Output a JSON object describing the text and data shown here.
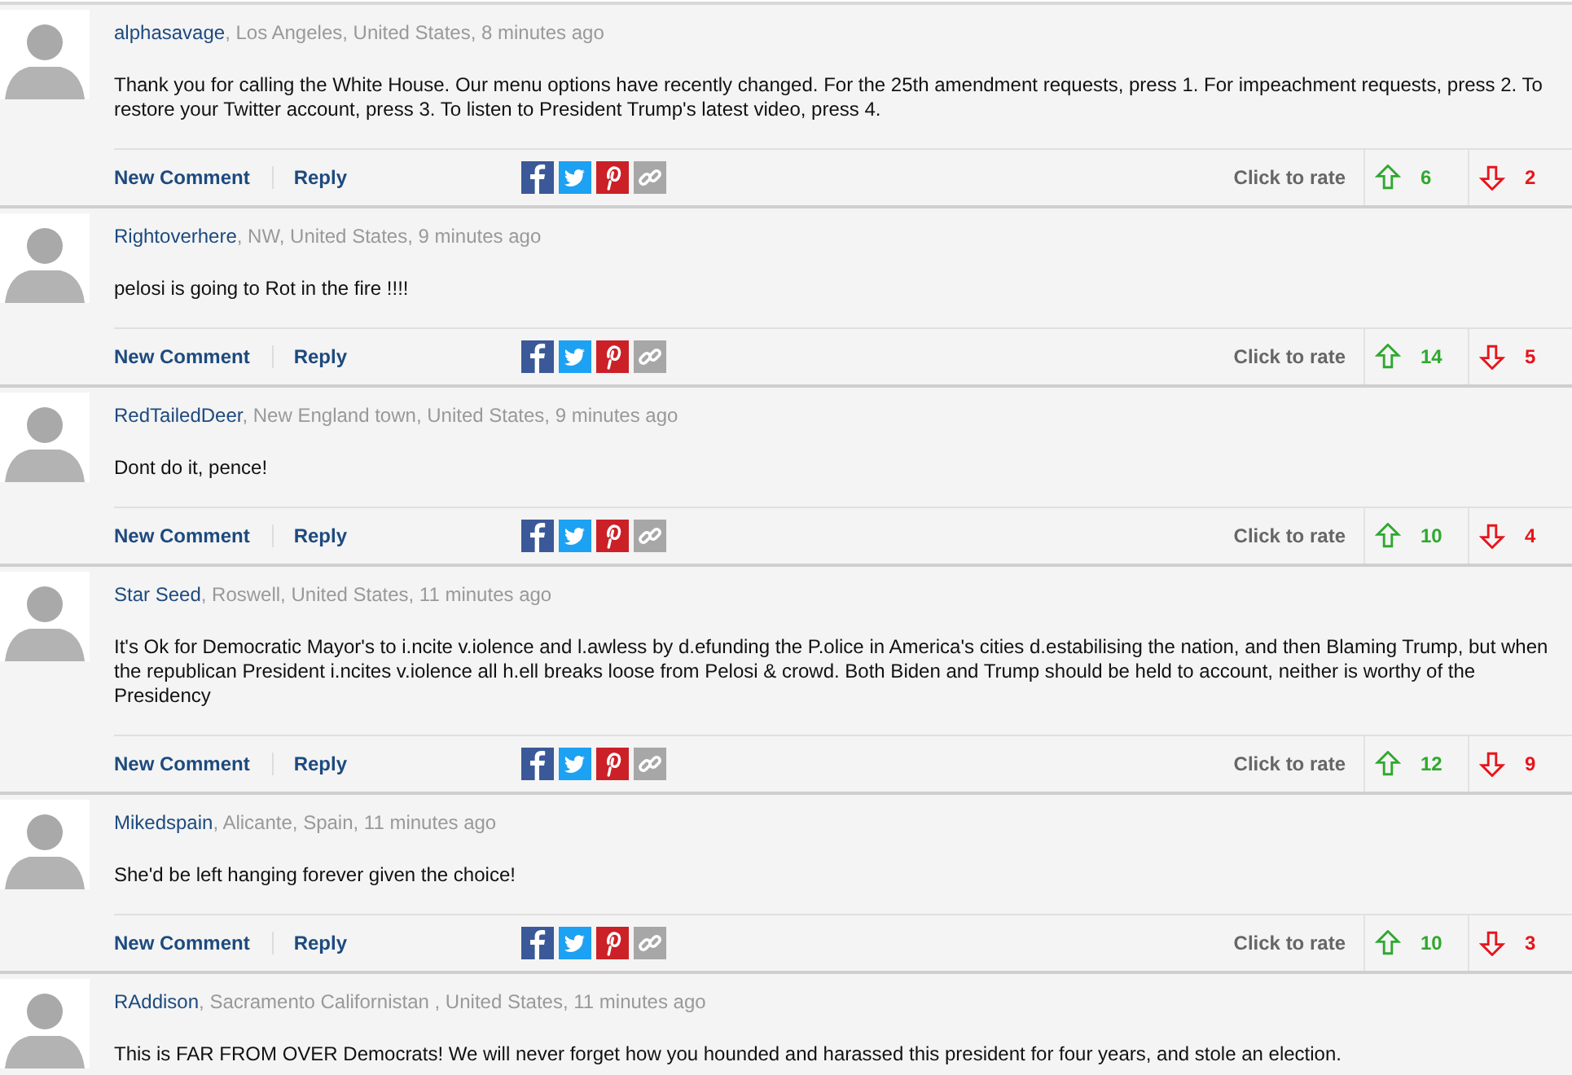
{
  "comments": [
    {
      "author": "alphasavage",
      "meta": ", Los Angeles, United States, 8 minutes ago",
      "body": "Thank you for calling the White House. Our menu options have recently changed. For the 25th amendment requests, press 1. For impeachment requests, press 2. To restore your Twitter account, press 3. To listen to President Trump's latest video, press 4.",
      "actions": [
        "New Comment",
        "Reply"
      ],
      "rate_label": "Click to rate",
      "up": "6",
      "down": "2"
    },
    {
      "author": "Rightoverhere",
      "meta": ", NW, United States, 9 minutes ago",
      "body": "pelosi is going to Rot in the fire !!!!",
      "actions": [
        "New Comment",
        "Reply"
      ],
      "rate_label": "Click to rate",
      "up": "14",
      "down": "5"
    },
    {
      "author": "RedTailedDeer",
      "meta": ", New England town, United States, 9 minutes ago",
      "body": "Dont do it, pence!",
      "actions": [
        "New Comment",
        "Reply"
      ],
      "rate_label": "Click to rate",
      "up": "10",
      "down": "4"
    },
    {
      "author": "Star Seed",
      "meta": ", Roswell, United States, 11 minutes ago",
      "body": "It's Ok for Democratic Mayor's to i.ncite v.iolence and l.awless by d.efunding the P.olice in America's cities d.estabilising the nation, and then Blaming Trump, but when the republican President i.ncites v.iolence all h.ell breaks loose from Pelosi & crowd. Both Biden and Trump should be held to account, neither is worthy of the Presidency",
      "actions": [
        "New Comment",
        "Reply"
      ],
      "rate_label": "Click to rate",
      "up": "12",
      "down": "9"
    },
    {
      "author": "Mikedspain",
      "meta": ", Alicante, Spain, 11 minutes ago",
      "body": "She'd be left hanging forever given the choice!",
      "actions": [
        "New Comment",
        "Reply"
      ],
      "rate_label": "Click to rate",
      "up": "10",
      "down": "3"
    },
    {
      "author": "RAddison",
      "meta": ", Sacramento Californistan , United States, 11 minutes ago",
      "body": "This is FAR FROM OVER Democrats! We will never forget how you hounded and harassed this president for four years, and stole an election."
    }
  ]
}
